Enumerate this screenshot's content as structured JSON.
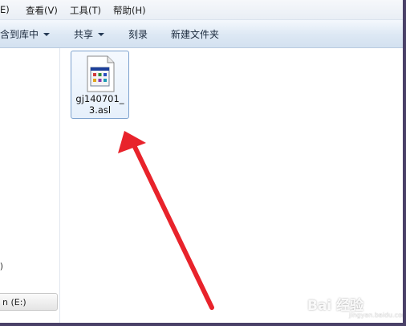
{
  "menu": {
    "edit_partial": "E)",
    "view": "查看(V)",
    "tools": "工具(T)",
    "help": "帮助(H)"
  },
  "toolbar": {
    "include_library": "含到库中",
    "share": "共享",
    "burn": "刻录",
    "new_folder": "新建文件夹"
  },
  "nav": {
    "partial_label": ":)",
    "drive_label": "n (E:)"
  },
  "file": {
    "name_line1": "gj140701_",
    "name_line2": "3.asl",
    "icon": "document-file-icon"
  },
  "watermark": {
    "text": "Bai 经验",
    "url": "jingyan.baidu.com"
  },
  "colors": {
    "frame": "#4a4168",
    "arrow": "#e8232b",
    "selection_border": "#7da2ce",
    "toolbar": "#dde8f4"
  }
}
